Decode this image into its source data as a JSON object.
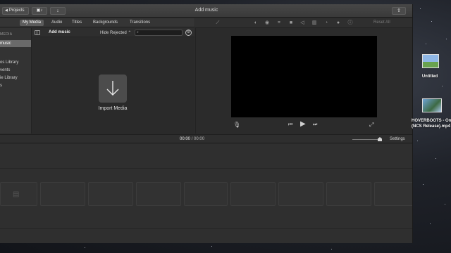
{
  "window": {
    "title": "Add music",
    "projects_label": "Projects",
    "projects_icon": "chevron-left",
    "media_icon": "film-music-icon",
    "import_icon": "import-arrow-icon",
    "share_icon": "share-icon"
  },
  "tabs": [
    "My Media",
    "Audio",
    "Titles",
    "Backgrounds",
    "Transitions"
  ],
  "sidebar": {
    "heading": "MEDIA",
    "items": [
      "music",
      "os Library",
      "vents",
      "ie Library",
      "s"
    ]
  },
  "browser": {
    "title": "Add music",
    "filter": "Hide Rejected",
    "filter_arrow": "⌃",
    "search_icon": "⌕",
    "import_label": "Import Media"
  },
  "viewer_tools": {
    "icons": [
      "magic-wand-icon",
      "color-balance-icon",
      "color-correction-icon",
      "crop-icon",
      "stabilization-icon",
      "volume-icon",
      "noise-reduction-icon",
      "speed-icon",
      "filter-icon",
      "info-icon"
    ],
    "reset_label": "Reset All"
  },
  "viewer": {
    "controls": [
      "mic-icon",
      "skip-back-icon",
      "play-icon",
      "skip-forward-icon",
      "fullscreen-icon"
    ]
  },
  "timeline": {
    "current_time": "00:00",
    "separator": "/",
    "total_time": "00:00",
    "settings_label": "Settings"
  },
  "desktop": {
    "items": [
      {
        "label": "Untitled"
      },
      {
        "label_line1": "HOVERBOOTS - One",
        "label_line2": "(NCS Release).mp4"
      }
    ]
  }
}
